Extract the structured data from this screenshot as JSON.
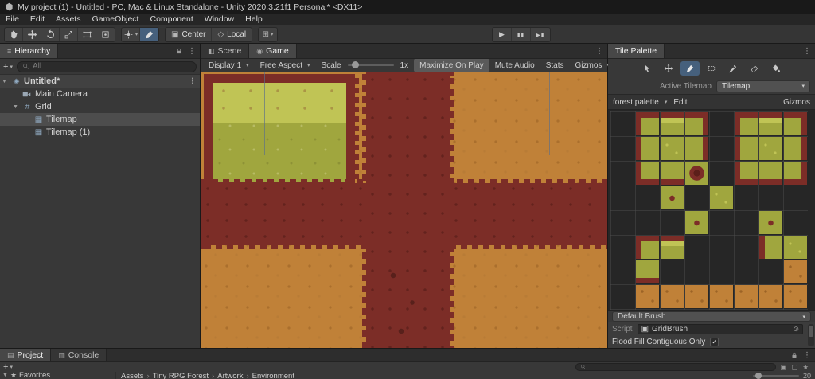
{
  "colors": {
    "ground": "#c08138",
    "road": "#7c2d27",
    "grass": "#a0a63e",
    "grass_light": "#c0c455",
    "selection": "#4d4d4d",
    "accent": "#46607c"
  },
  "icons": {
    "dropdown": "▾",
    "kebab": "⋮",
    "check": "✓",
    "star": "★",
    "plus": "+",
    "sep": "›",
    "play": "▶",
    "pause": "▮▮",
    "step": "▶▮",
    "grid": "#",
    "tilemap": "▦",
    "scene_asset": "◈",
    "scene_tab": "◧",
    "game_tab": "◉",
    "project_tab": "▤",
    "console_tab": "▥",
    "target": "⊙",
    "script": "▣",
    "arrow_down": "▼",
    "arrow_right": "▶",
    "center": "▣",
    "local": "◇",
    "snap": "⊞",
    "search_filter1": "▣",
    "search_filter2": "▢"
  },
  "title_bar": {
    "title": "My project (1) - Untitled - PC, Mac & Linux Standalone - Unity 2020.3.21f1 Personal* <DX11>"
  },
  "menu": {
    "items": [
      "File",
      "Edit",
      "Assets",
      "GameObject",
      "Component",
      "Window",
      "Help"
    ]
  },
  "toolbar": {
    "pivot": "Center",
    "space": "Local"
  },
  "hierarchy": {
    "tab": "Hierarchy",
    "search_placeholder": "All",
    "scene_name": "Untitled*",
    "items": [
      {
        "label": "Main Camera"
      },
      {
        "label": "Grid"
      },
      {
        "label": "Tilemap"
      },
      {
        "label": "Tilemap (1)"
      }
    ]
  },
  "game_view": {
    "tab_scene": "Scene",
    "tab_game": "Game",
    "display": "Display 1",
    "aspect": "Free Aspect",
    "scale_label": "Scale",
    "scale_value": "1x",
    "buttons": [
      "Maximize On Play",
      "Mute Audio",
      "Stats",
      "Gizmos"
    ]
  },
  "tile_palette": {
    "tab": "Tile Palette",
    "active_tilemap_label": "Active Tilemap",
    "active_tilemap_value": "Tilemap",
    "palette_name": "forest palette",
    "edit": "Edit",
    "gizmos": "Gizmos",
    "default_brush": "Default Brush",
    "script_label": "Script",
    "script_value": "GridBrush",
    "flood_fill": "Flood Fill Contiguous Only",
    "flood_fill_checked": true,
    "tiles": [
      {
        "r": 0,
        "c": 1,
        "k": "corner-tl"
      },
      {
        "r": 0,
        "c": 2,
        "k": "edge-top"
      },
      {
        "r": 0,
        "c": 3,
        "k": "corner-tr"
      },
      {
        "r": 0,
        "c": 5,
        "k": "corner-tl"
      },
      {
        "r": 0,
        "c": 6,
        "k": "edge-top"
      },
      {
        "r": 0,
        "c": 7,
        "k": "corner-tr"
      },
      {
        "r": 1,
        "c": 1,
        "k": "edge-left"
      },
      {
        "r": 1,
        "c": 2,
        "k": "grass"
      },
      {
        "r": 1,
        "c": 3,
        "k": "edge-right"
      },
      {
        "r": 1,
        "c": 5,
        "k": "edge-left"
      },
      {
        "r": 1,
        "c": 6,
        "k": "grass"
      },
      {
        "r": 1,
        "c": 7,
        "k": "edge-right"
      },
      {
        "r": 2,
        "c": 1,
        "k": "corner-bl"
      },
      {
        "r": 2,
        "c": 2,
        "k": "edge-bottom"
      },
      {
        "r": 2,
        "c": 3,
        "k": "bush"
      },
      {
        "r": 2,
        "c": 5,
        "k": "corner-bl"
      },
      {
        "r": 2,
        "c": 6,
        "k": "edge-bottom"
      },
      {
        "r": 2,
        "c": 7,
        "k": "corner-br"
      },
      {
        "r": 3,
        "c": 2,
        "k": "dot"
      },
      {
        "r": 3,
        "c": 4,
        "k": "grass"
      },
      {
        "r": 4,
        "c": 3,
        "k": "dot"
      },
      {
        "r": 4,
        "c": 6,
        "k": "dot"
      },
      {
        "r": 5,
        "c": 1,
        "k": "corner-tl"
      },
      {
        "r": 5,
        "c": 2,
        "k": "edge-top"
      },
      {
        "r": 5,
        "c": 6,
        "k": "edge-left"
      },
      {
        "r": 5,
        "c": 7,
        "k": "grass"
      },
      {
        "r": 6,
        "c": 1,
        "k": "edge-bottom"
      },
      {
        "r": 6,
        "c": 7,
        "k": "dirt"
      },
      {
        "r": 7,
        "c": 1,
        "k": "dirt"
      },
      {
        "r": 7,
        "c": 2,
        "k": "dirt"
      },
      {
        "r": 7,
        "c": 3,
        "k": "dirt"
      },
      {
        "r": 7,
        "c": 4,
        "k": "dirt"
      },
      {
        "r": 7,
        "c": 5,
        "k": "dirt"
      },
      {
        "r": 7,
        "c": 6,
        "k": "dirt"
      },
      {
        "r": 7,
        "c": 7,
        "k": "dirt"
      }
    ]
  },
  "project": {
    "tab_project": "Project",
    "tab_console": "Console",
    "favorites": "Favorites",
    "breadcrumb": [
      "Assets",
      "Tiny RPG Forest",
      "Artwork",
      "Environment"
    ],
    "zoom_badge": "20"
  }
}
